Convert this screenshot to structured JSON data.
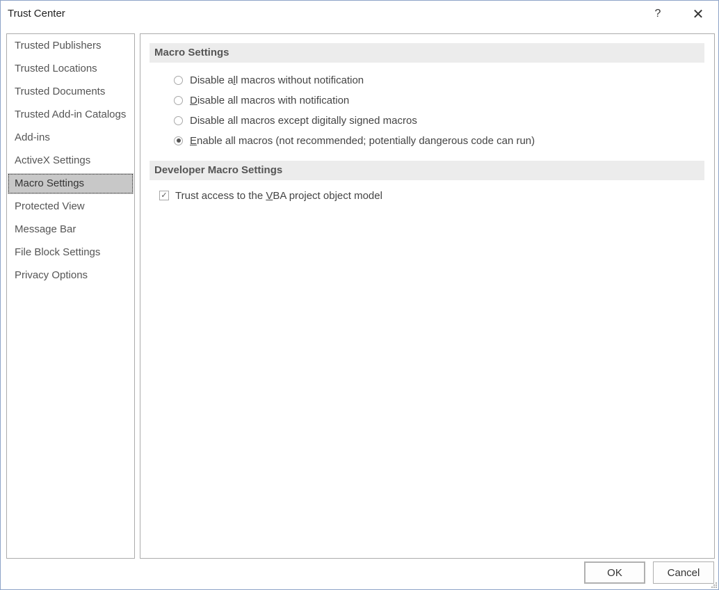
{
  "window": {
    "title": "Trust Center",
    "help_label": "?",
    "close_label": "✕"
  },
  "sidebar": {
    "selected": "Macro Settings",
    "items": [
      {
        "label": "Trusted Publishers"
      },
      {
        "label": "Trusted Locations"
      },
      {
        "label": "Trusted Documents"
      },
      {
        "label": "Trusted Add-in Catalogs"
      },
      {
        "label": "Add-ins"
      },
      {
        "label": "ActiveX Settings"
      },
      {
        "label": "Macro Settings"
      },
      {
        "label": "Protected View"
      },
      {
        "label": "Message Bar"
      },
      {
        "label": "File Block Settings"
      },
      {
        "label": "Privacy Options"
      }
    ]
  },
  "macro_settings": {
    "header": "Macro Settings",
    "options": [
      {
        "pre": "Disable a",
        "key": "l",
        "post": "l macros without notification",
        "checked": false
      },
      {
        "pre": "",
        "key": "D",
        "post": "isable all macros with notification",
        "checked": false
      },
      {
        "pre": "Disable all macros except di",
        "key": "g",
        "post": "itally signed macros",
        "checked": false
      },
      {
        "pre": "",
        "key": "E",
        "post": "nable all macros (not recommended; potentially dangerous code can run)",
        "checked": true
      }
    ]
  },
  "developer_settings": {
    "header": "Developer Macro Settings",
    "trust_vba": {
      "pre": "Trust access to the ",
      "key": "V",
      "post": "BA project object model",
      "checked": true
    }
  },
  "footer": {
    "ok_label": "OK",
    "cancel_label": "Cancel"
  }
}
